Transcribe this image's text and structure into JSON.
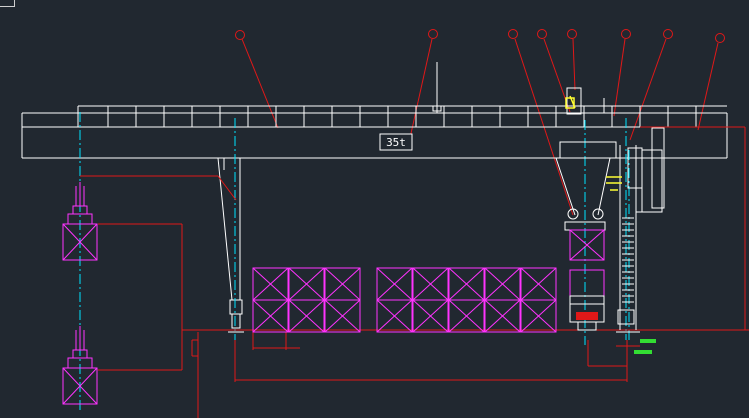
{
  "drawing": {
    "capacity_label": "35t",
    "balloon_count": 8,
    "container_stacks": {
      "left_group": 3,
      "right_group": 5
    }
  },
  "colors": {
    "background": "#212830",
    "structure": "#ffffff",
    "centerline": "#00e5ff",
    "dimension": "#ff2020",
    "container": "#ff33ff",
    "trolley": "#ffff33",
    "marker": "#33dd33",
    "truck_light": "#ff2020"
  }
}
